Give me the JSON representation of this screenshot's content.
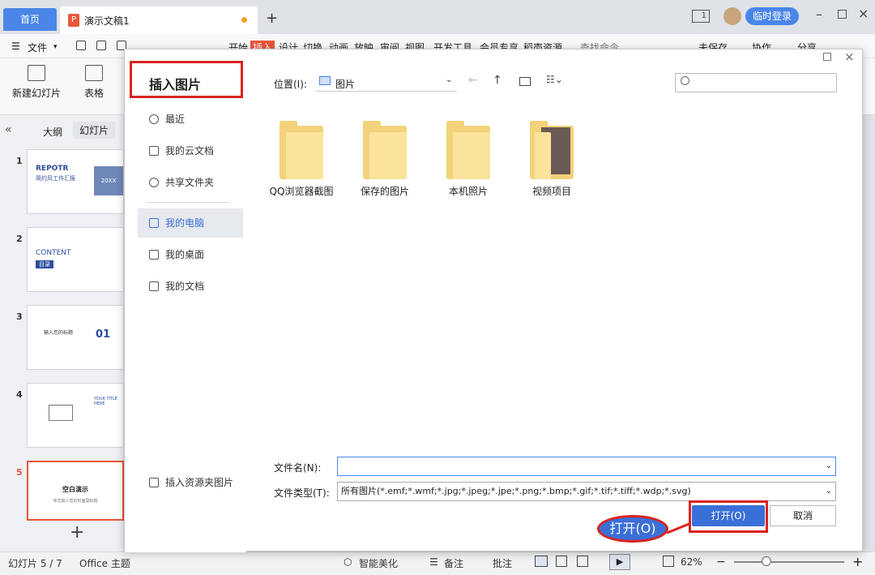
{
  "titlebar": {
    "home_tab": "首页",
    "doc_tab": "演示文稿1",
    "add_tab": "+",
    "layout_btn": "1",
    "login": "临时登录"
  },
  "menubar": {
    "file": "文件",
    "items": [
      "开始",
      "插入",
      "设计",
      "切换",
      "动画",
      "放映",
      "审阅",
      "视图",
      "开发工具",
      "会员专享",
      "稻壳资源"
    ],
    "search_cmd": "查找命令...",
    "unsaved": "未保存",
    "collab": "协作",
    "share": "分享"
  },
  "ribbon": {
    "new_slide": "新建幻灯片",
    "table": "表格"
  },
  "leftpanel": {
    "outline_tab": "大纲",
    "slides_tab": "幻灯片",
    "slides": [
      {
        "num": "1",
        "title": "REPOTR",
        "subtitle": "简约风工作汇报",
        "year": "20XX"
      },
      {
        "num": "2",
        "title": "CONTENT",
        "subtitle": "目录"
      },
      {
        "num": "3",
        "title": "输入您的标题",
        "badge": "01"
      },
      {
        "num": "4",
        "title": "YOUR TITLE HERE"
      },
      {
        "num": "5",
        "title": "空白演示",
        "subtitle": "单击输入您的封面副标题"
      }
    ],
    "add_slide": "+"
  },
  "statusbar": {
    "slide_pos": "幻灯片 5 / 7",
    "theme": "Office 主题",
    "beautify": "智能美化",
    "notes": "备注",
    "comments": "批注",
    "zoom": "62%"
  },
  "dialog": {
    "title": "插入图片",
    "nav": [
      {
        "label": "最近",
        "icon": "clock-icon"
      },
      {
        "label": "我的云文档",
        "icon": "cloud-icon"
      },
      {
        "label": "共享文件夹",
        "icon": "share-icon"
      },
      {
        "label": "我的电脑",
        "icon": "monitor-icon"
      },
      {
        "label": "我的桌面",
        "icon": "desktop-icon"
      },
      {
        "label": "我的文档",
        "icon": "documents-icon"
      }
    ],
    "resource_folder": "插入资源夹图片",
    "location_label": "位置(I):",
    "location_value": "图片",
    "search_placeholder": "",
    "folders": [
      "QQ浏览器截图",
      "保存的图片",
      "本机照片",
      "视频项目"
    ],
    "filename_label": "文件名(N):",
    "filename_value": "",
    "filetype_label": "文件类型(T):",
    "filetype_value": "所有图片(*.emf;*.wmf;*.jpg;*.jpeg;*.jpe;*.png;*.bmp;*.gif;*.tif;*.tiff;*.wdp;*.svg)",
    "open_btn": "打开(O)",
    "cancel_btn": "取消",
    "callout": "打开(O)"
  },
  "colors": {
    "accent": "#4a86e8",
    "brand": "#e8563b",
    "highlight": "#d9241f"
  }
}
